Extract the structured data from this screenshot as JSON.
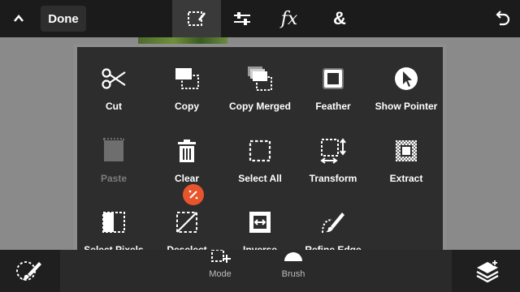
{
  "topbar": {
    "done_label": "Done",
    "tabs": [
      "select-icon",
      "adjustments-icon",
      "fx",
      "&"
    ],
    "fx_label": "fx",
    "amp_label": "&"
  },
  "menu": {
    "items": [
      {
        "label": "Cut",
        "icon": "scissors-icon",
        "enabled": true
      },
      {
        "label": "Copy",
        "icon": "copy-icon",
        "enabled": true
      },
      {
        "label": "Copy Merged",
        "icon": "copy-merged-icon",
        "enabled": true
      },
      {
        "label": "Feather",
        "icon": "feather-icon",
        "enabled": true
      },
      {
        "label": "Show Pointer",
        "icon": "pointer-icon",
        "enabled": true
      },
      {
        "label": "Paste",
        "icon": "paste-icon",
        "enabled": false
      },
      {
        "label": "Clear",
        "icon": "trash-icon",
        "enabled": true
      },
      {
        "label": "Select All",
        "icon": "select-all-icon",
        "enabled": true
      },
      {
        "label": "Transform",
        "icon": "transform-icon",
        "enabled": true
      },
      {
        "label": "Extract",
        "icon": "extract-icon",
        "enabled": true
      },
      {
        "label": "Select Pixels",
        "icon": "select-pixels-icon",
        "enabled": true
      },
      {
        "label": "Deselect",
        "icon": "deselect-icon",
        "enabled": true
      },
      {
        "label": "Inverse",
        "icon": "inverse-icon",
        "enabled": true
      },
      {
        "label": "Refine Edge",
        "icon": "refine-edge-icon",
        "enabled": true
      }
    ]
  },
  "bottombar": {
    "mode_label": "Mode",
    "brush_label": "Brush"
  },
  "colors": {
    "accent": "#e8542c",
    "menu_bg": "#2d2d2d",
    "bar_bg": "#1b1b1b"
  }
}
